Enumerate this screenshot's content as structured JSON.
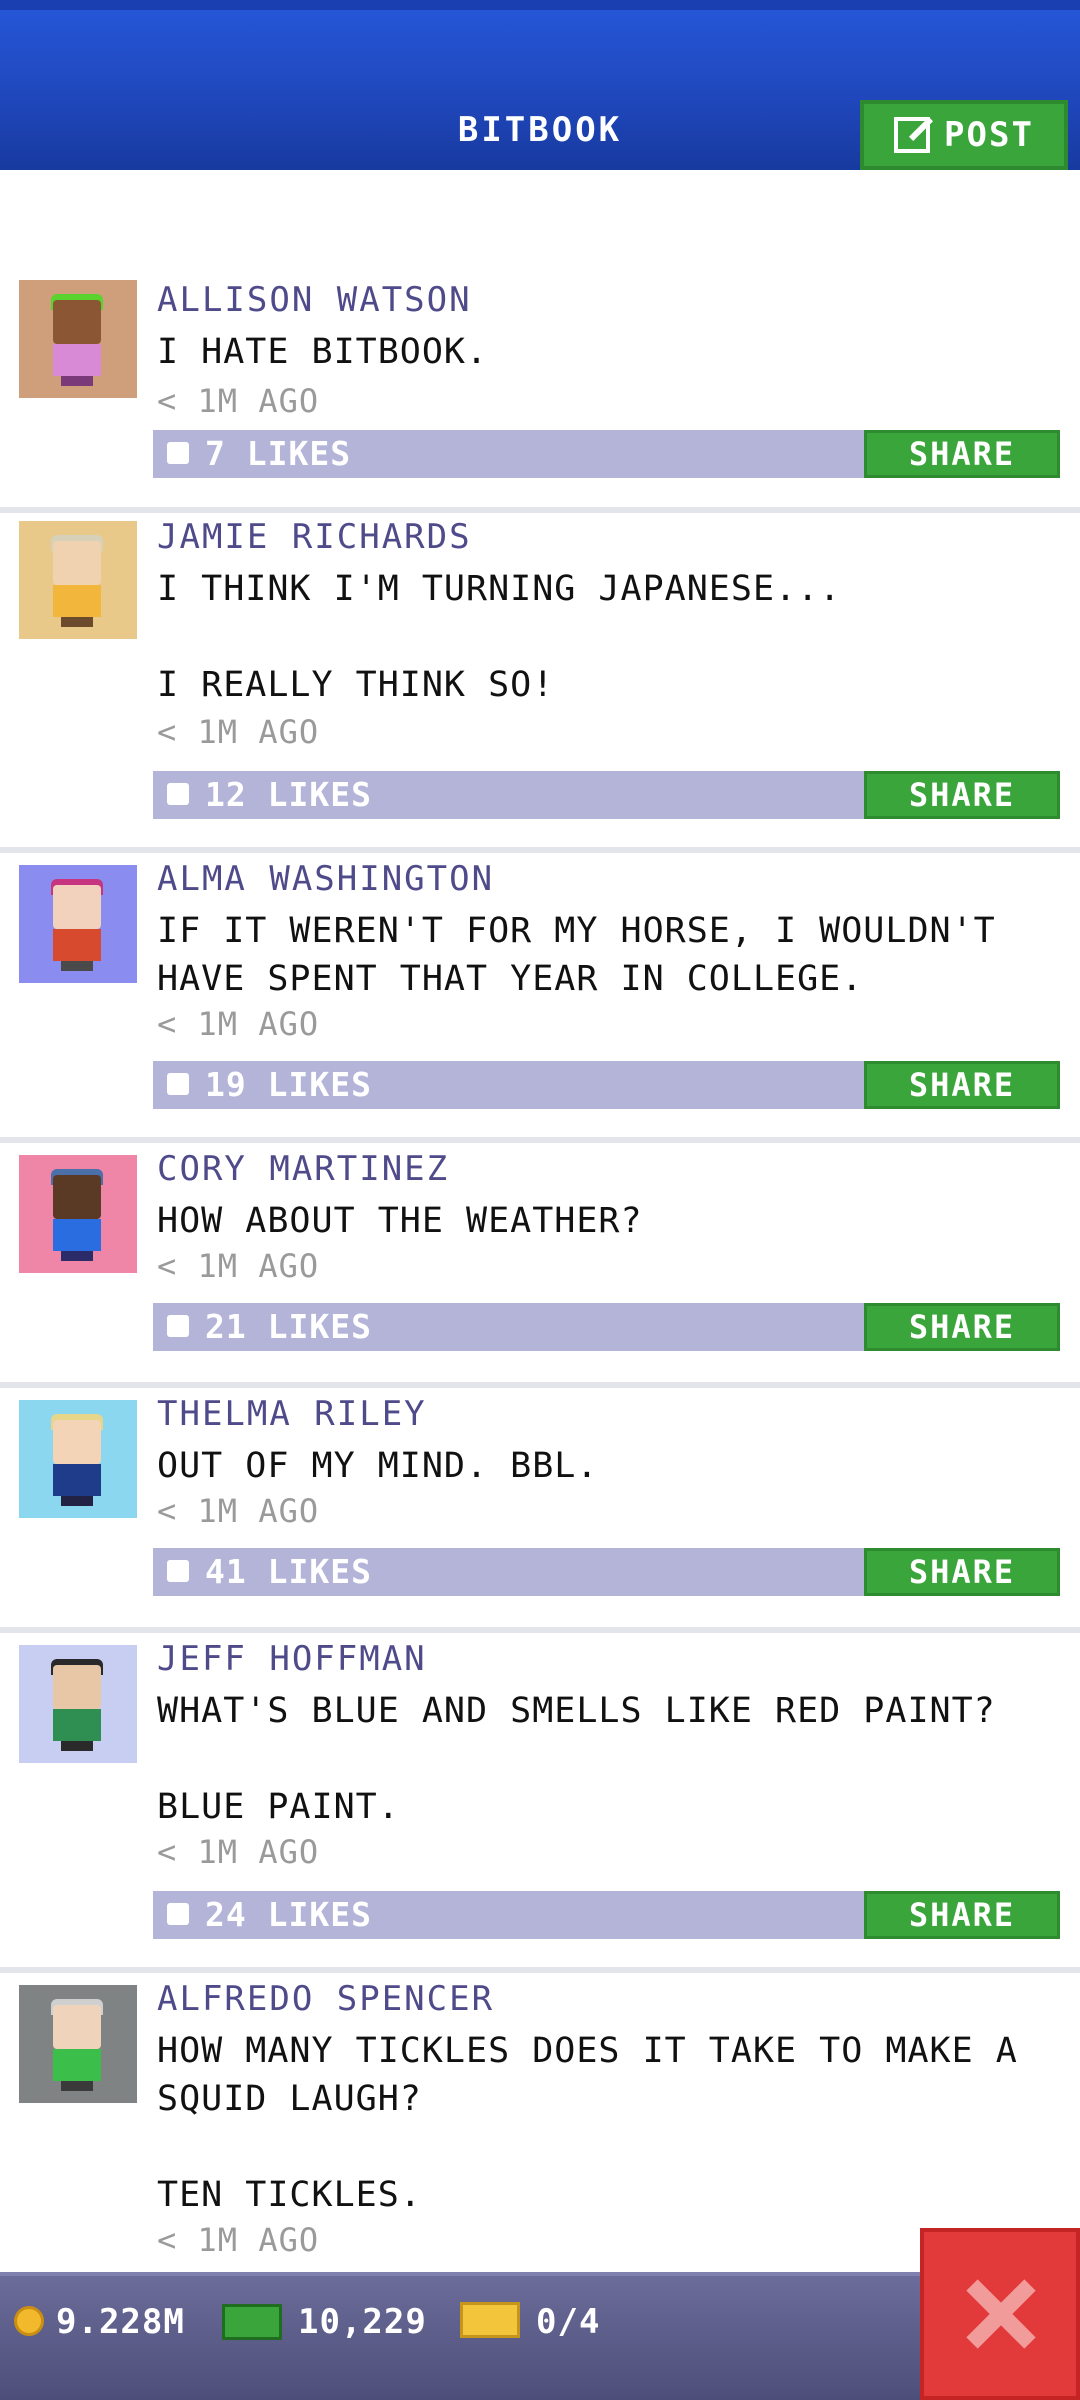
{
  "header": {
    "title": "BITBOOK",
    "post_label": "POST"
  },
  "posts": [
    {
      "name": "ALLISON WATSON",
      "text": "I HATE BITBOOK.",
      "time": "< 1M AGO",
      "likes": "7 LIKES",
      "share": "SHARE",
      "colors": {
        "bg": "#cf9f7b",
        "hair": "#5bd32f",
        "skin": "#8a5634",
        "shirt": "#d98ad6",
        "legs": "#7a3a7a"
      }
    },
    {
      "name": "JAMIE RICHARDS",
      "text": "I THINK I'M TURNING JAPANESE...\n\nI REALLY THINK SO!",
      "time": "< 1M AGO",
      "likes": "12 LIKES",
      "share": "SHARE",
      "colors": {
        "bg": "#e9c98a",
        "hair": "#d8d1b9",
        "skin": "#f0d2b0",
        "shirt": "#f2b63c",
        "legs": "#6c4a2c"
      }
    },
    {
      "name": "ALMA WASHINGTON",
      "text": "IF IT WEREN'T FOR MY HORSE, I WOULDN'T\nHAVE SPENT THAT YEAR IN COLLEGE.",
      "time": "< 1M AGO",
      "likes": "19 LIKES",
      "share": "SHARE",
      "colors": {
        "bg": "#8a8cf0",
        "hair": "#c7347f",
        "skin": "#f2d2bc",
        "shirt": "#d84a2e",
        "legs": "#4a4a4a"
      }
    },
    {
      "name": "CORY MARTINEZ",
      "text": "HOW ABOUT THE WEATHER?",
      "time": "< 1M AGO",
      "likes": "21 LIKES",
      "share": "SHARE",
      "colors": {
        "bg": "#ef86a8",
        "hair": "#4b6fa8",
        "skin": "#5a3a24",
        "shirt": "#2a6de0",
        "legs": "#2b2b6a"
      }
    },
    {
      "name": "THELMA RILEY",
      "text": "OUT OF MY MIND. BBL.",
      "time": "< 1M AGO",
      "likes": "41 LIKES",
      "share": "SHARE",
      "colors": {
        "bg": "#8bd7ef",
        "hair": "#e7d58a",
        "skin": "#f3d4b6",
        "shirt": "#1e3c8a",
        "legs": "#222244"
      }
    },
    {
      "name": "JEFF HOFFMAN",
      "text": "WHAT'S BLUE AND SMELLS LIKE RED PAINT?\n\nBLUE PAINT.",
      "time": "< 1M AGO",
      "likes": "24 LIKES",
      "share": "SHARE",
      "colors": {
        "bg": "#c8cef1",
        "hair": "#2a2a2a",
        "skin": "#e8c7a6",
        "shirt": "#2f8f52",
        "legs": "#2a2a2a"
      }
    },
    {
      "name": "ALFREDO SPENCER",
      "text": "HOW MANY TICKLES DOES IT TAKE TO MAKE A\nSQUID LAUGH?\n\nTEN TICKLES.",
      "time": "< 1M AGO",
      "likes": "",
      "share": "",
      "colors": {
        "bg": "#7f8383",
        "hair": "#d0d0d0",
        "skin": "#f0d3bb",
        "shirt": "#3cbf4a",
        "legs": "#3a3a3a"
      }
    }
  ],
  "bottom": {
    "coins": "9.228M",
    "bux": "10,229",
    "tickets": "0/4"
  },
  "accent": {
    "header": "#1f46b9",
    "green": "#3aa53a",
    "likebar": "#b3b4d8",
    "close": "#e23a3a"
  }
}
